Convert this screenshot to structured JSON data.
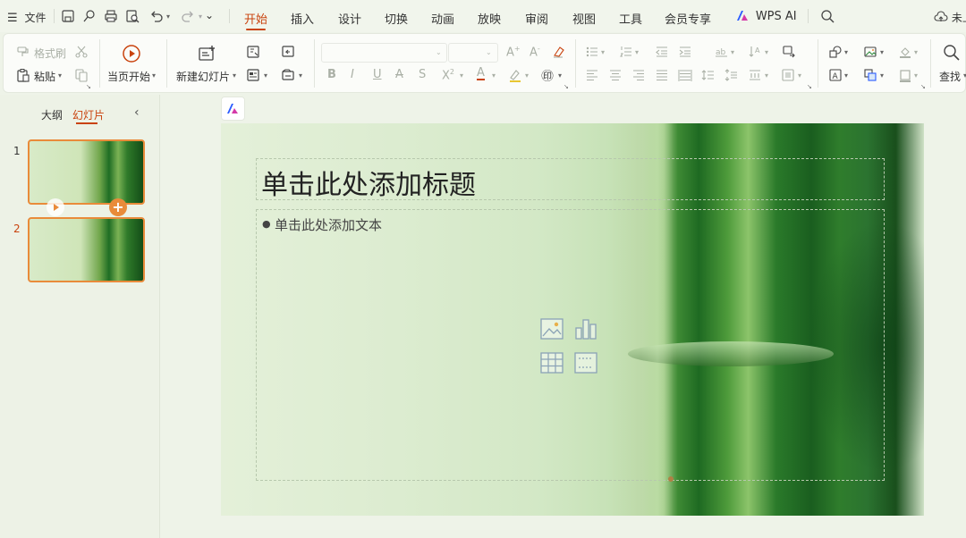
{
  "menubar": {
    "menu_label": "文件",
    "tabs": [
      {
        "label": "开始",
        "active": true
      },
      {
        "label": "插入",
        "active": false
      },
      {
        "label": "设计",
        "active": false
      },
      {
        "label": "切换",
        "active": false
      },
      {
        "label": "动画",
        "active": false
      },
      {
        "label": "放映",
        "active": false
      },
      {
        "label": "审阅",
        "active": false
      },
      {
        "label": "视图",
        "active": false
      },
      {
        "label": "工具",
        "active": false
      },
      {
        "label": "会员专享",
        "active": false
      },
      {
        "label": "WPS AI",
        "active": false
      }
    ],
    "sync_label": "未上"
  },
  "ribbon": {
    "format_painter": "格式刷",
    "paste": "粘贴",
    "play_current": "当页开始",
    "new_slide": "新建幻灯片",
    "find": "查找"
  },
  "leftpanel": {
    "tab_outline": "大纲",
    "tab_slides": "幻灯片",
    "slides": [
      {
        "number": "1"
      },
      {
        "number": "2"
      }
    ]
  },
  "slide": {
    "title_placeholder": "单击此处添加标题",
    "body_placeholder": "单击此处添加文本"
  },
  "colors": {
    "accent": "#c9430e",
    "thumb_border": "#e98b3a"
  }
}
